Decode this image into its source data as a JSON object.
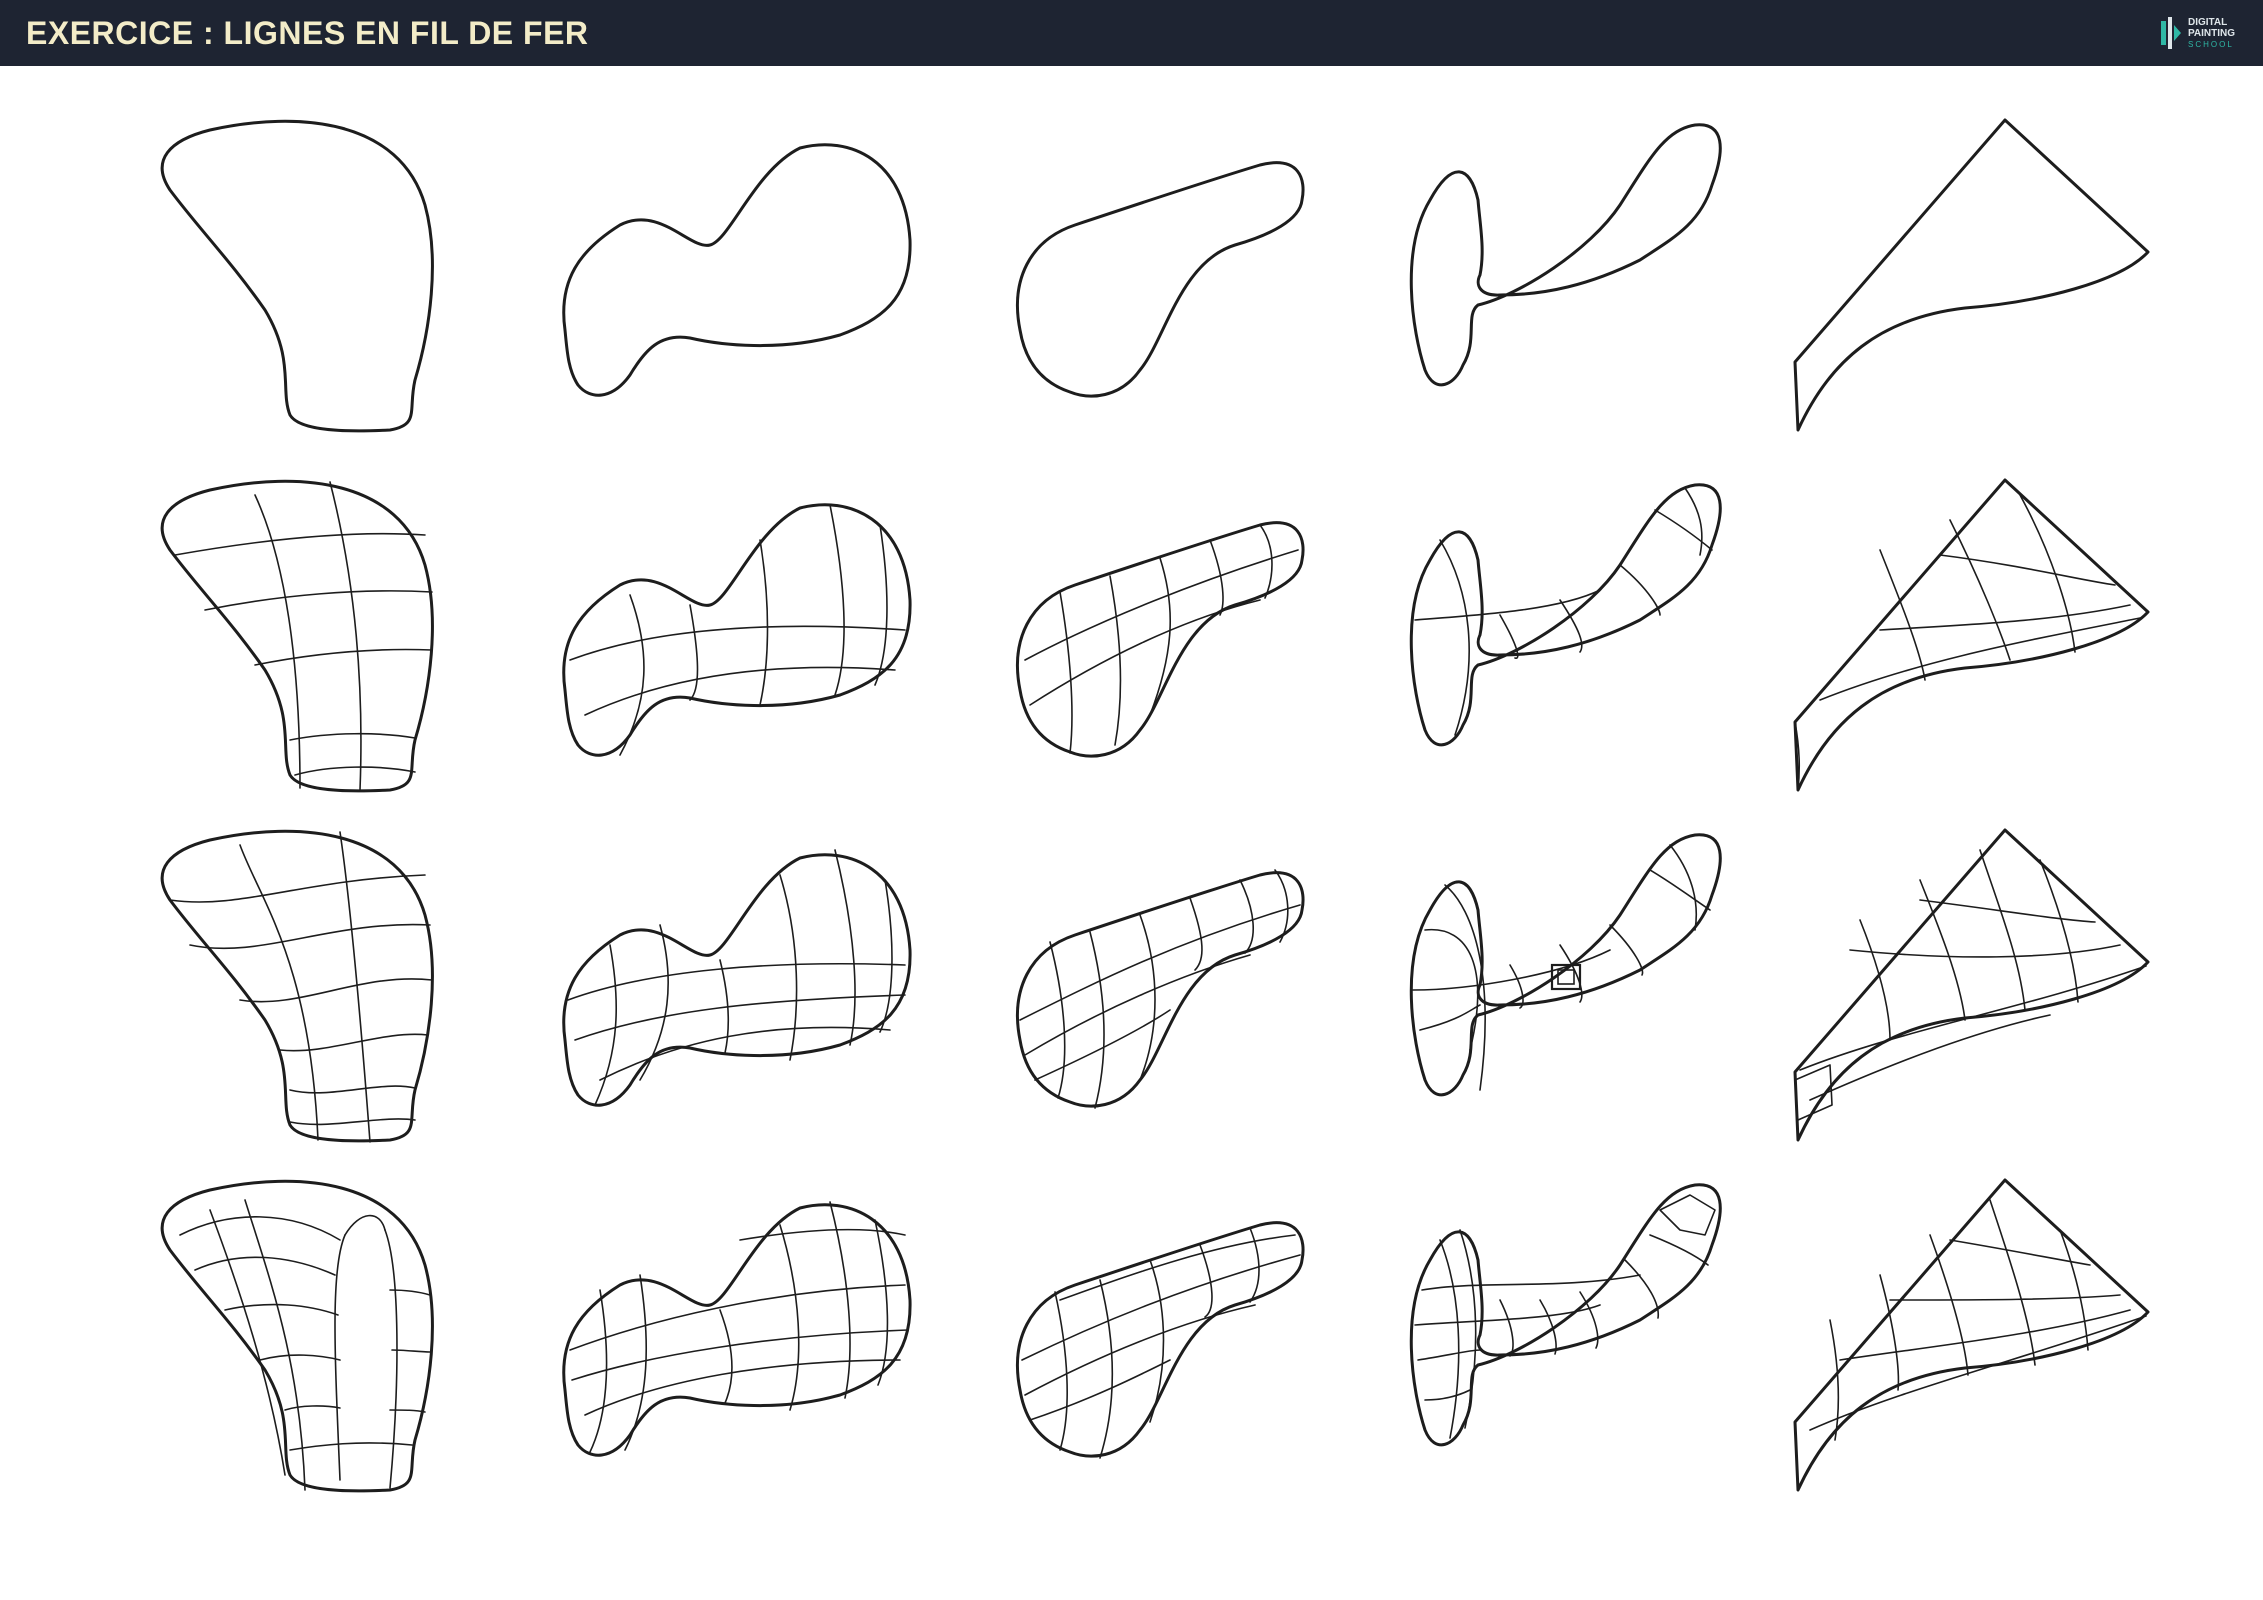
{
  "header": {
    "title": "EXERCICE : LIGNES EN FIL DE FER",
    "logo": {
      "line1": "DIGITAL",
      "line2": "PAINTING",
      "line3": "SCHOOL",
      "icon": "digital-painting-school-logo-icon"
    }
  },
  "colors": {
    "header_background": "#1e2432",
    "title": "#f3ecc8",
    "logo_accent": "#2fb8a6",
    "line": "#1d1d1d",
    "background": "#ffffff"
  },
  "drawing": {
    "rows": 4,
    "columns": 5,
    "row_content": [
      "outline-only",
      "wireframe-simple",
      "wireframe-medium",
      "wireframe-dense"
    ]
  }
}
